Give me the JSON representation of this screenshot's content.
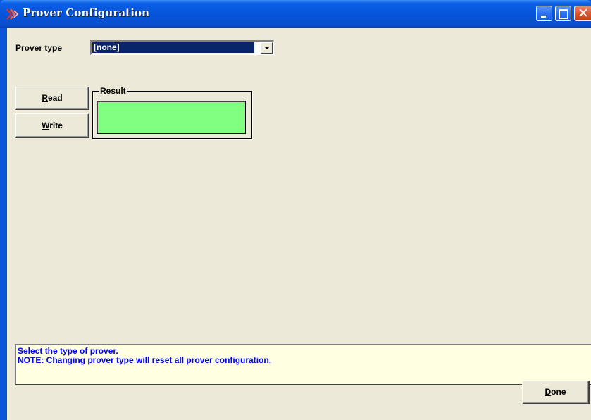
{
  "window": {
    "title": "Prover Configuration",
    "controls": {
      "minimize": "minimize-icon",
      "maximize": "maximize-icon",
      "close": "close-icon"
    }
  },
  "form": {
    "prover_type_label": "Prover type",
    "prover_type_value": "[none]"
  },
  "buttons": {
    "read_mnemonic": "R",
    "read_rest": "ead",
    "write_mnemonic": "W",
    "write_rest": "rite",
    "done_mnemonic": "D",
    "done_rest": "one"
  },
  "result": {
    "legend": "Result",
    "value": "",
    "color": "#80ff80"
  },
  "status": {
    "line1": "Select the type of prover.",
    "line2": "NOTE: Changing prover type will reset all prover configuration."
  },
  "colors": {
    "titlebar": "#0653d8",
    "client_bg": "#ece9d8",
    "status_bg": "#ffffe1",
    "status_text": "#0000ff",
    "selection_bg": "#0a246a"
  }
}
